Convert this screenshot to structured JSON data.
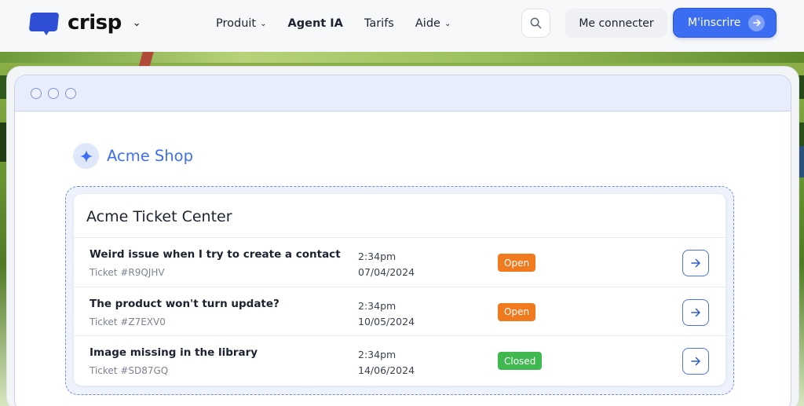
{
  "header": {
    "logo_text": "crisp",
    "nav": [
      {
        "label": "Produit",
        "has_dropdown": true
      },
      {
        "label": "Agent IA",
        "has_dropdown": false
      },
      {
        "label": "Tarifs",
        "has_dropdown": false
      },
      {
        "label": "Aide",
        "has_dropdown": true
      }
    ],
    "login_label": "Me connecter",
    "signup_label": "M'inscrire"
  },
  "brand": {
    "name": "Acme Shop",
    "icon": "sparkle-icon"
  },
  "ticket_center": {
    "title": "Acme Ticket Center",
    "rows": [
      {
        "title": "Weird issue when I try to create a contact",
        "ticket": "Ticket #R9QJHV",
        "time": "2:34pm",
        "date": "07/04/2024",
        "status": "Open"
      },
      {
        "title": "The product won't turn update?",
        "ticket": "Ticket #Z7EXV0",
        "time": "2:34pm",
        "date": "10/05/2024",
        "status": "Open"
      },
      {
        "title": "Image missing in the library",
        "ticket": "Ticket #SD87GQ",
        "time": "2:34pm",
        "date": "14/06/2024",
        "status": "Closed"
      }
    ]
  },
  "colors": {
    "accent": "#3b6df2",
    "open": "#f07a1e",
    "closed": "#3fb84f"
  }
}
